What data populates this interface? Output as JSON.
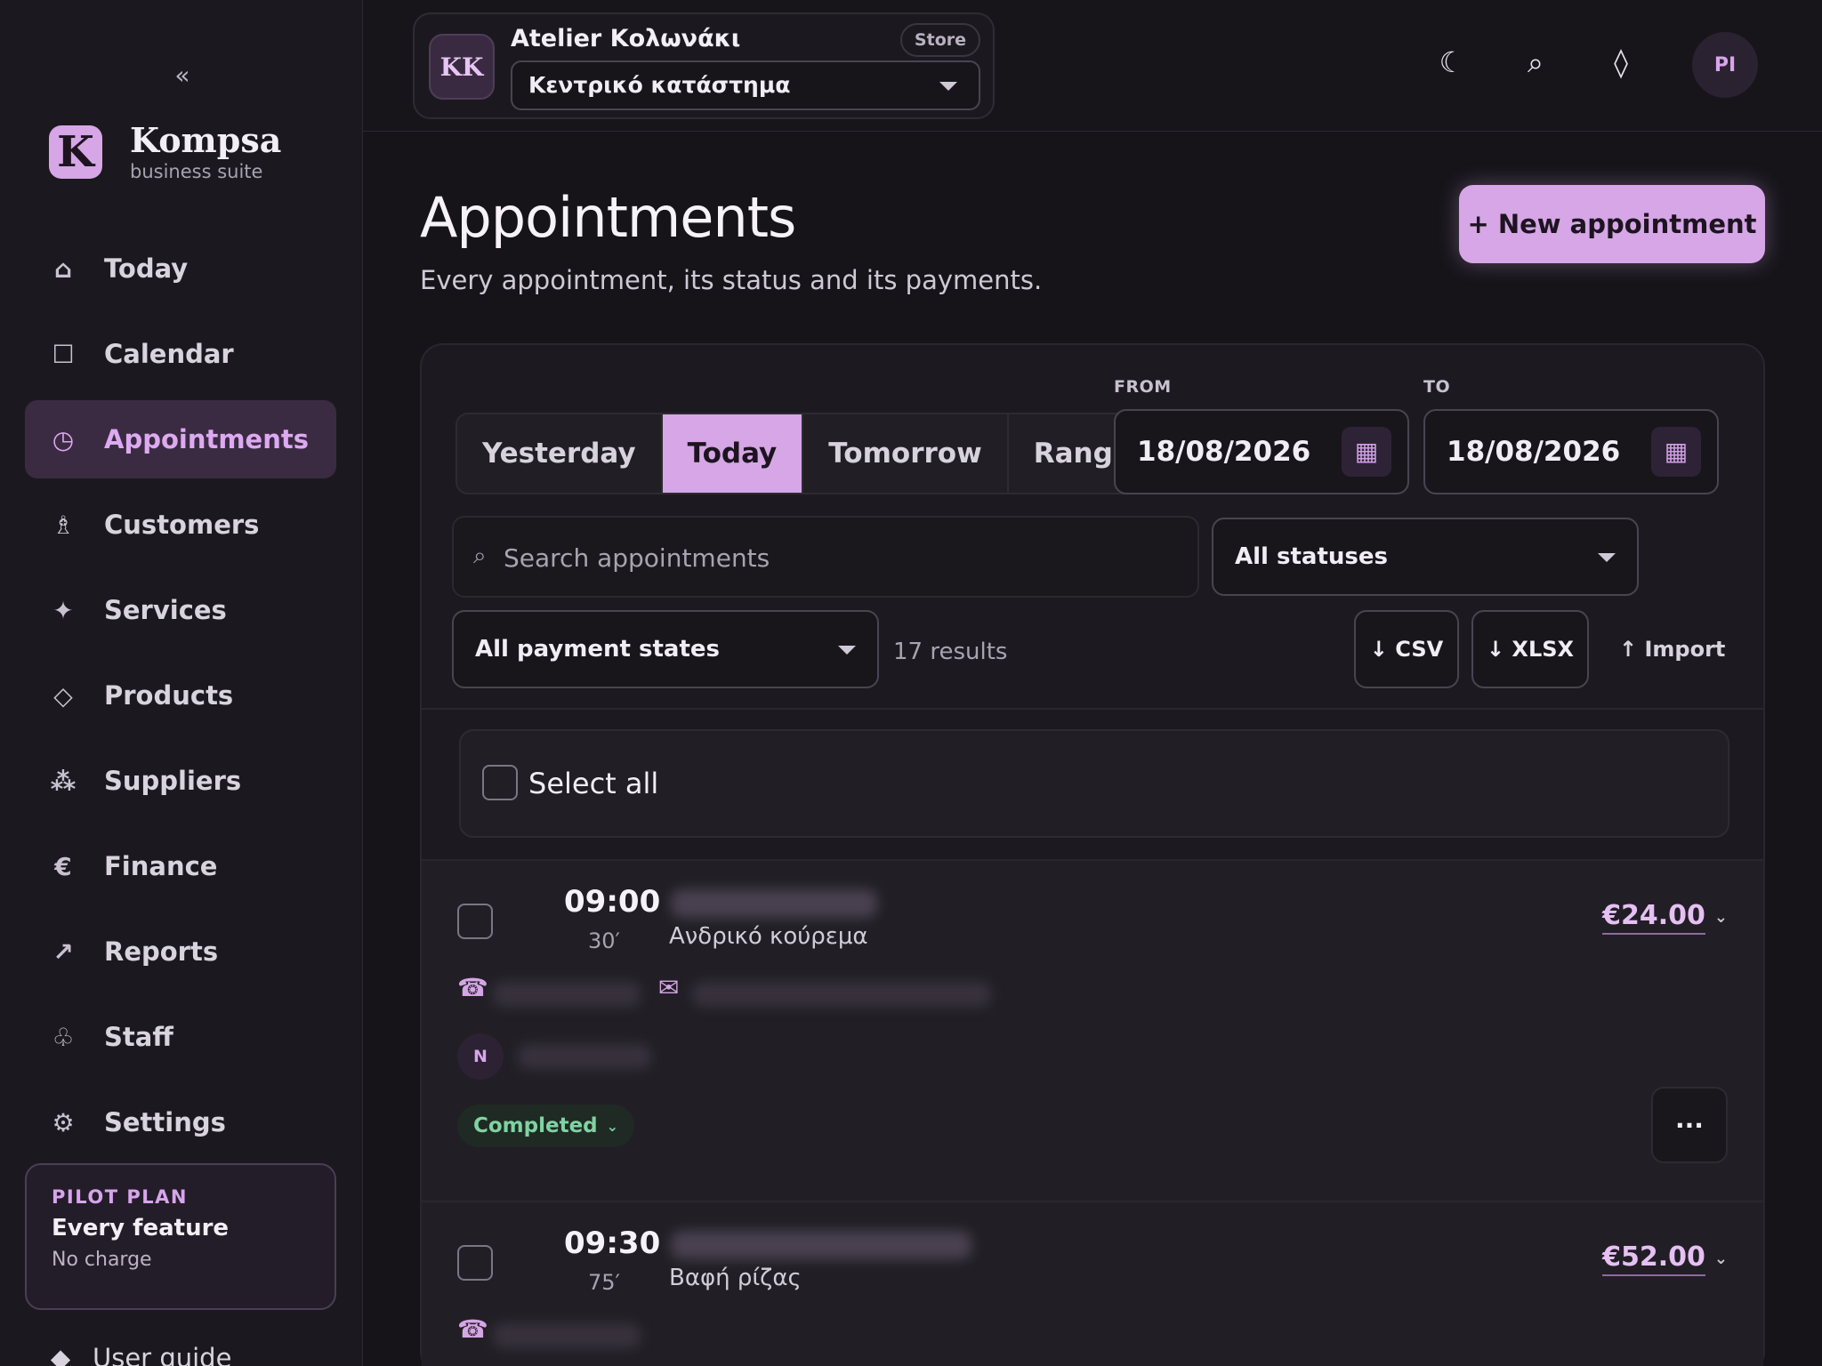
{
  "sidebar": {
    "collapse_label": "«",
    "brand": {
      "logo_letter": "K",
      "name": "Kompsa",
      "subtitle": "business suite"
    },
    "items": [
      {
        "label": "Today",
        "icon": "⌂"
      },
      {
        "label": "Calendar",
        "icon": "☐"
      },
      {
        "label": "Appointments",
        "icon": "◷",
        "active": true
      },
      {
        "label": "Customers",
        "icon": "♗"
      },
      {
        "label": "Services",
        "icon": "✦"
      },
      {
        "label": "Products",
        "icon": "◇"
      },
      {
        "label": "Suppliers",
        "icon": "⁂"
      },
      {
        "label": "Finance",
        "icon": "€"
      },
      {
        "label": "Reports",
        "icon": "↗"
      },
      {
        "label": "Staff",
        "icon": "♧"
      },
      {
        "label": "Settings",
        "icon": "⚙"
      }
    ],
    "plan": {
      "label": "PILOT PLAN",
      "title": "Every feature",
      "subtitle": "No charge"
    },
    "user_guide": {
      "label": "User guide",
      "icon": "◆"
    }
  },
  "topbar": {
    "store": {
      "initials": "KK",
      "name": "Atelier Κολωνάκι",
      "badge": "Store",
      "selected_location": "Κεντρικό κατάστημα"
    },
    "icons": {
      "theme": "☾",
      "search": "⌕",
      "diamond": "◊"
    },
    "user_initials": "PI"
  },
  "page": {
    "title": "Appointments",
    "subtitle": "Every appointment, its status and its payments.",
    "new_button": "+ New appointment"
  },
  "filters": {
    "tabs": [
      "Yesterday",
      "Today",
      "Tomorrow",
      "Range"
    ],
    "active_tab": "Today",
    "from_label": "FROM",
    "from_value": "18/08/2026",
    "to_label": "TO",
    "to_value": "18/08/2026",
    "calendar_icon": "▦",
    "search_icon": "⌕",
    "search_placeholder": "Search appointments",
    "status_select": "All statuses",
    "payment_select": "All payment states",
    "results": "17 results",
    "export_csv": "↓ CSV",
    "export_xlsx": "↓ XLSX",
    "import": "↑ Import"
  },
  "list": {
    "select_all": "Select all",
    "appointments": [
      {
        "time": "09:00",
        "duration": "30′",
        "service": "Ανδρικό κούρεμα",
        "price": "€24.00",
        "staff_initial": "N",
        "status": "Completed",
        "more": "···",
        "phone_icon": "☎",
        "email_icon": "✉"
      },
      {
        "time": "09:30",
        "duration": "75′",
        "service": "Βαφή ρίζας",
        "price": "€52.00",
        "phone_icon": "☎"
      }
    ]
  },
  "colors": {
    "accent": "#d6a6e6",
    "background": "#161419",
    "status_completed": "#7fd3a1"
  }
}
